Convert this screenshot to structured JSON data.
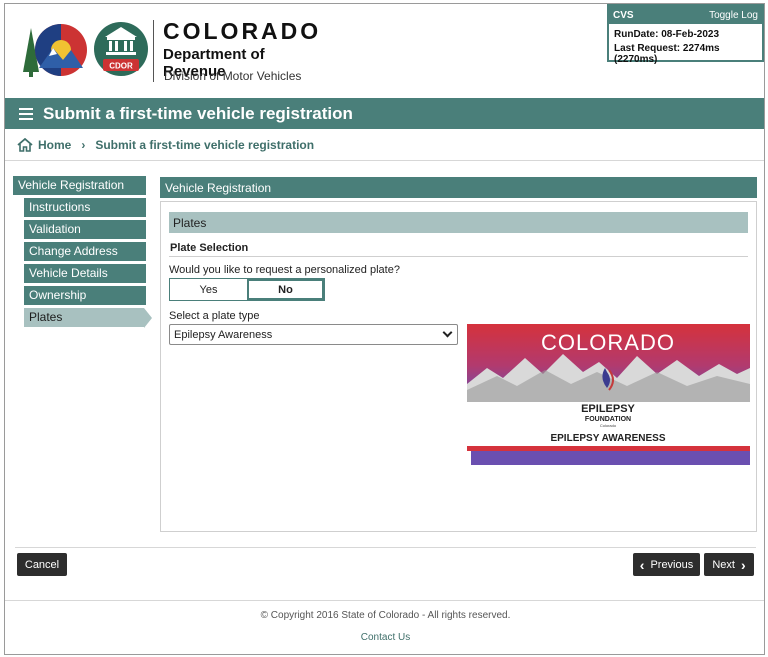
{
  "header": {
    "org_name": "COLORADO",
    "department": "Department of Revenue",
    "division": "Division of Motor Vehicles",
    "seal_text": "CDOR"
  },
  "cvs": {
    "label": "CVS",
    "toggle_log": "Toggle Log",
    "run_date": "RunDate: 08-Feb-2023",
    "last_request": "Last Request: 2274ms (2270ms)"
  },
  "page": {
    "title": "Submit a first-time vehicle registration"
  },
  "breadcrumb": {
    "home": "Home",
    "current": "Submit a first-time vehicle registration"
  },
  "sidebar": {
    "heading": "Vehicle Registration",
    "items": [
      {
        "label": "Instructions"
      },
      {
        "label": "Validation"
      },
      {
        "label": "Change Address"
      },
      {
        "label": "Vehicle Details"
      },
      {
        "label": "Ownership"
      },
      {
        "label": "Plates"
      }
    ]
  },
  "panel": {
    "heading": "Vehicle Registration",
    "section": "Plates",
    "subsection": "Plate Selection",
    "question": "Would you like to request a personalized plate?",
    "option_yes": "Yes",
    "option_no": "No",
    "select_label": "Select a plate type",
    "select_value": "Epilepsy Awareness"
  },
  "plate_image": {
    "state": "COLORADO",
    "org_line1": "EPILEPSY",
    "org_line2": "FOUNDATION",
    "org_line3": "Colorado",
    "caption": "EPILEPSY AWARENESS"
  },
  "footer": {
    "cancel": "Cancel",
    "previous": "Previous",
    "next": "Next",
    "copyright": "© Copyright 2016 State of Colorado - All rights reserved.",
    "contact": "Contact Us"
  },
  "colors": {
    "accent": "#4a7f7a",
    "accent_light": "#a8c1c0",
    "button_dark": "#2d2d2d"
  }
}
